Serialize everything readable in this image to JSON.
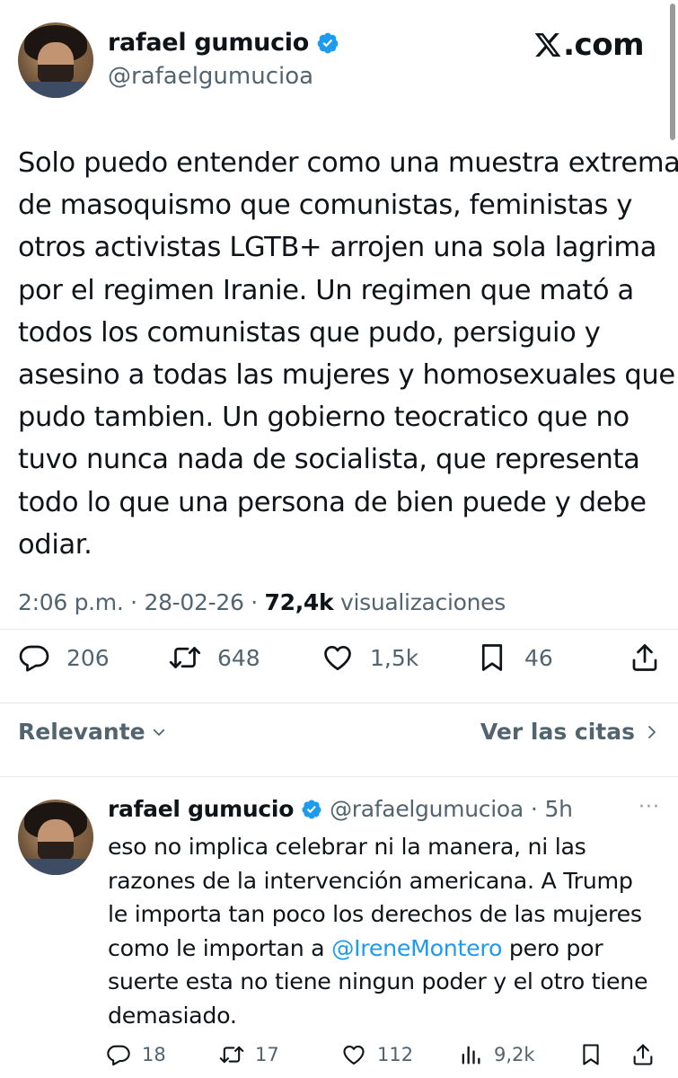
{
  "brand": {
    "site": "X.com",
    "accent": "#1d9bf0"
  },
  "tweet": {
    "author_name": "rafael gumucio",
    "author_handle": "@rafaelgumucioa",
    "text_lines": [
      "Solo puedo entender como una muestra extrema",
      "de masoquismo que comunistas, feministas y",
      "otros activistas LGTB+ arrojen una sola lagrima",
      "por el regimen Iranie. Un regimen que mató a",
      "todos los comunistas que pudo, persiguio y",
      "asesino a todas las mujeres y homosexuales que",
      "pudo tambien. Un gobierno teocratico que no",
      "tuvo nunca nada de socialista, que representa",
      "todo lo que una persona de bien puede y debe",
      "odiar."
    ],
    "time": "2:06 p.m.",
    "date": "28-02-26",
    "views": "72,4k",
    "views_label": "visualizaciones",
    "replies": "206",
    "reposts": "648",
    "likes": "1,5k",
    "bookmarks": "46"
  },
  "filter": {
    "sort_label": "Relevante",
    "quotes_label": "Ver las citas"
  },
  "reply": {
    "author_name": "rafael gumucio",
    "author_handle": "@rafaelgumucioa",
    "age": "5h",
    "more_icon": "···",
    "line1": "eso no implica celebrar ni la manera, ni las",
    "line2": "razones de la intervención americana. A Trump",
    "line3": "le importa tan poco los derechos de las mujeres",
    "line4_pre": "como le importan a ",
    "line4_mention": "@IreneMontero",
    "line4_post": " pero por",
    "line5": "suerte esta no tiene ningun poder y el otro tiene",
    "line6": "demasiado.",
    "replies": "18",
    "reposts": "17",
    "likes": "112",
    "views": "9,2k"
  },
  "icons": {
    "verified": "verified-badge-icon",
    "reply": "comment-icon",
    "repost": "repost-icon",
    "like": "heart-icon",
    "bookmark": "bookmark-icon",
    "share": "share-icon",
    "views": "analytics-icon"
  }
}
